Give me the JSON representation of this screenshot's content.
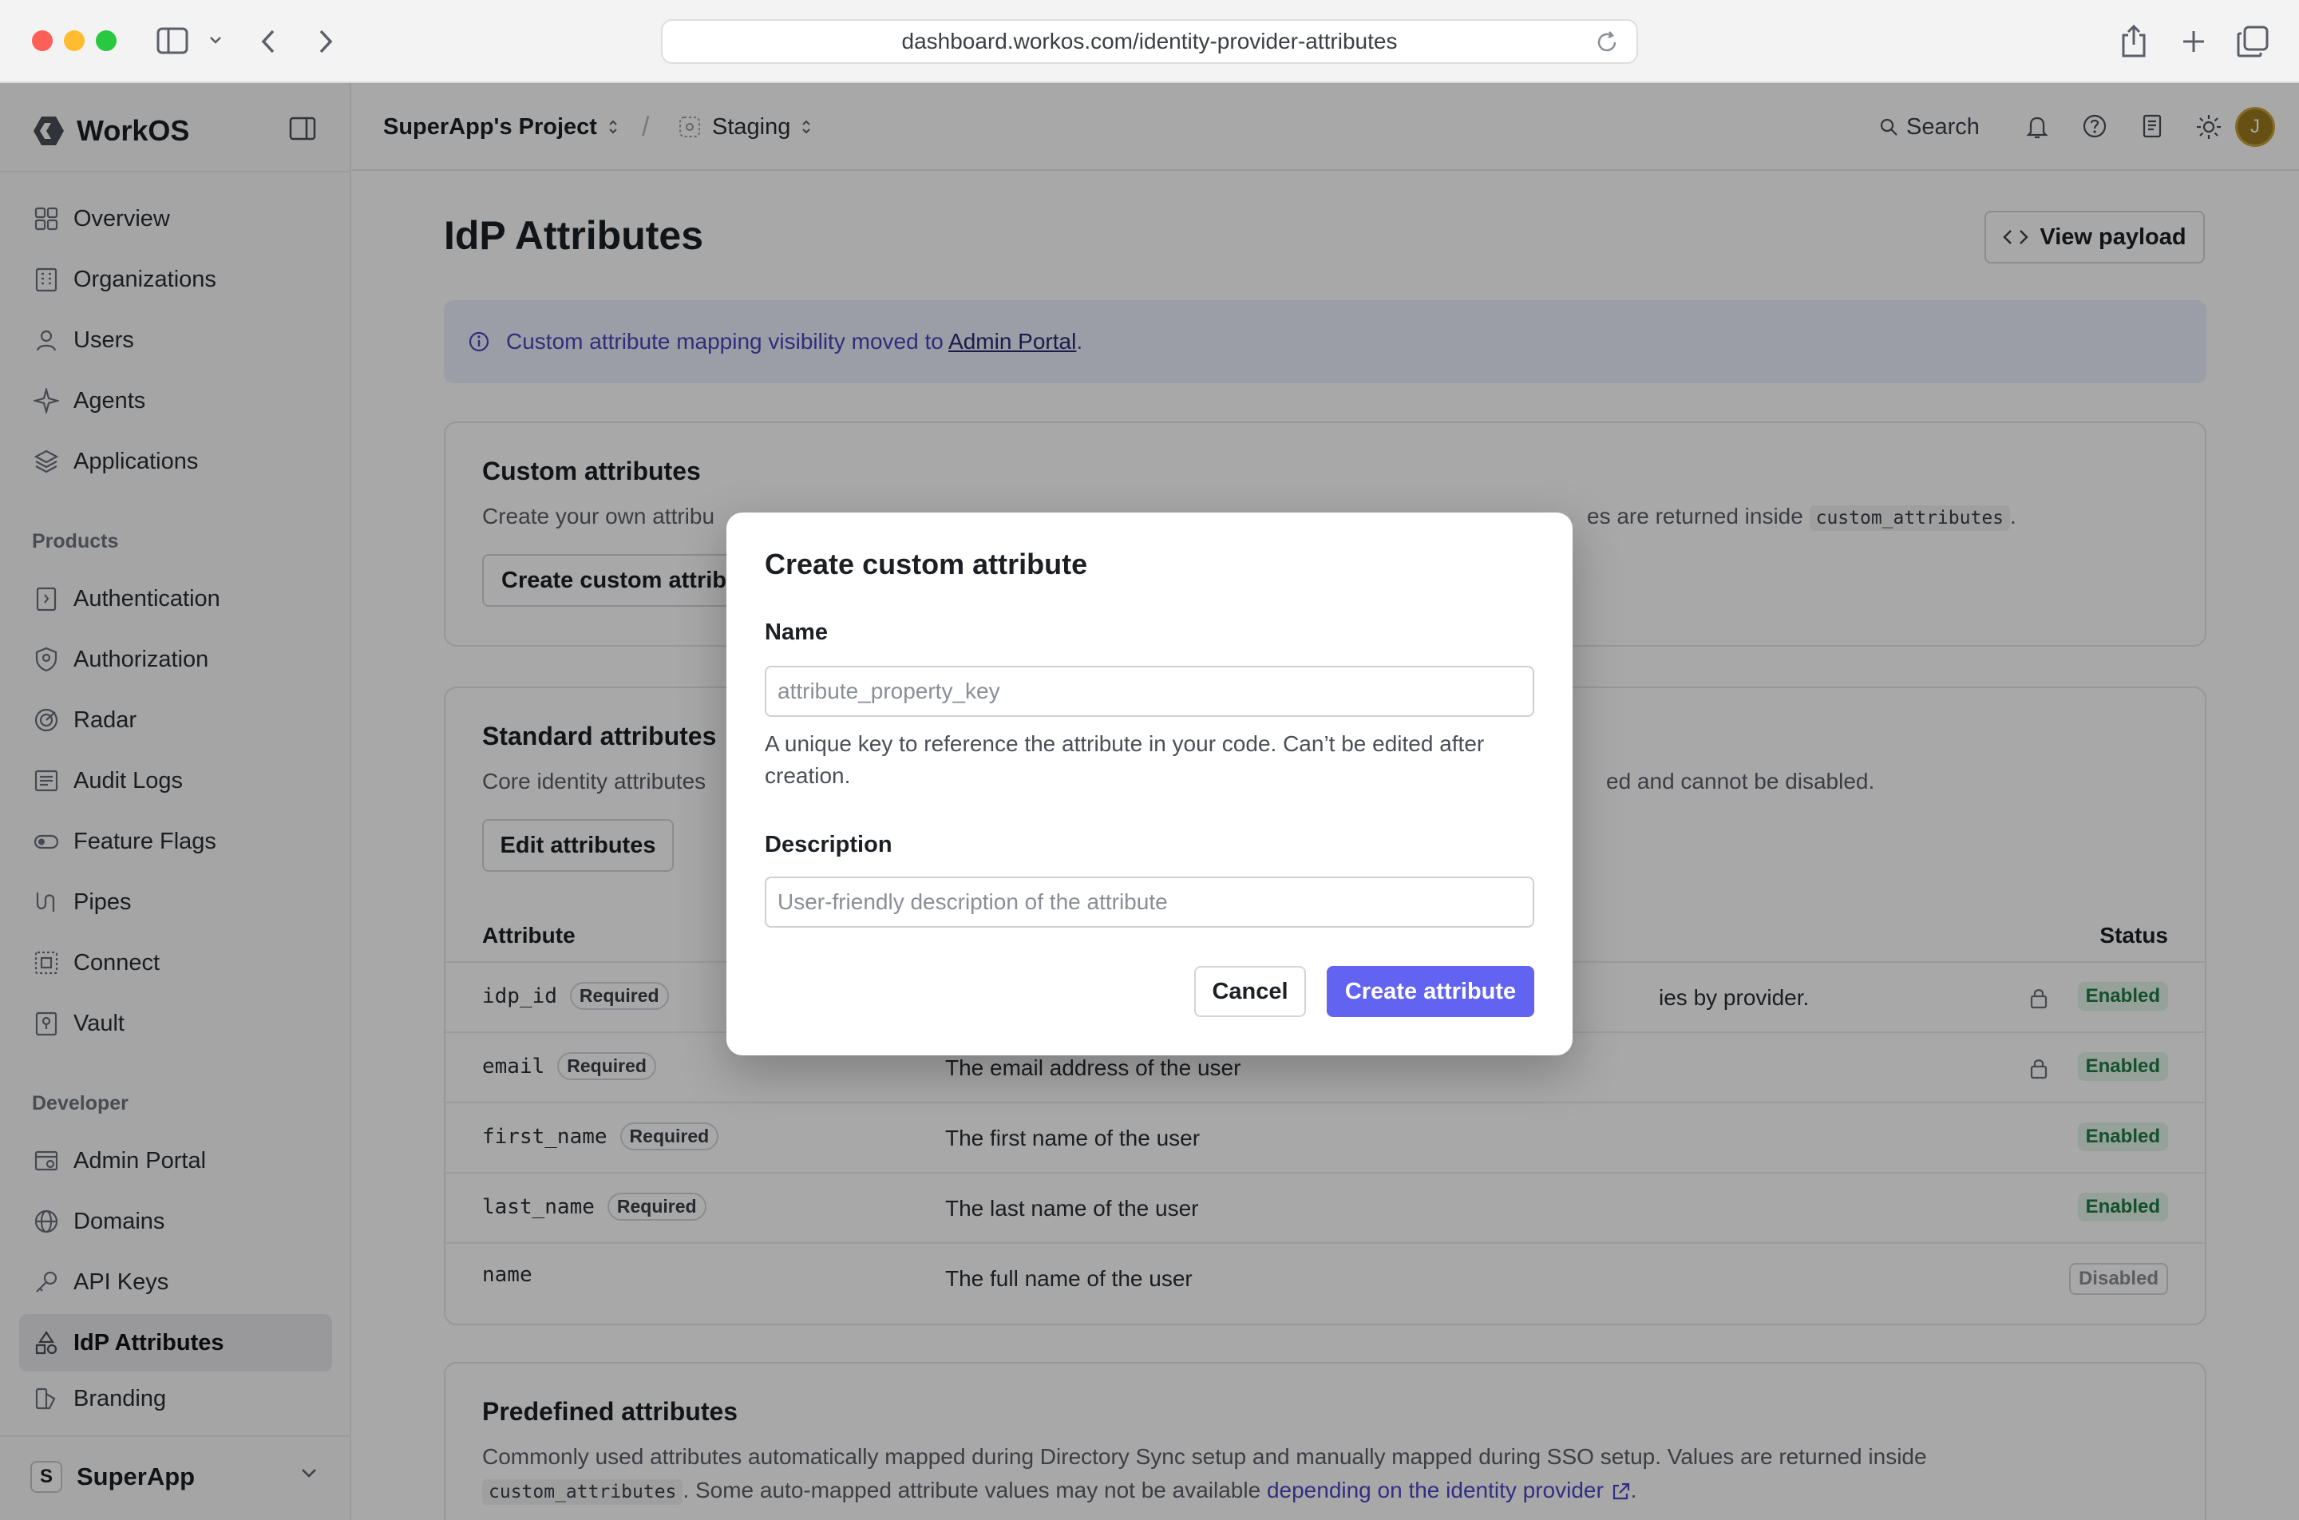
{
  "browser": {
    "url": "dashboard.workos.com/identity-provider-attributes"
  },
  "sidebar": {
    "brand": "WorkOS",
    "nav_top": [
      {
        "label": "Overview",
        "icon": "grid-icon"
      },
      {
        "label": "Organizations",
        "icon": "building-icon"
      },
      {
        "label": "Users",
        "icon": "user-icon"
      },
      {
        "label": "Agents",
        "icon": "sparkle-icon"
      },
      {
        "label": "Applications",
        "icon": "layers-icon"
      }
    ],
    "products_label": "Products",
    "nav_products": [
      {
        "label": "Authentication",
        "icon": "door-icon"
      },
      {
        "label": "Authorization",
        "icon": "shield-icon"
      },
      {
        "label": "Radar",
        "icon": "radar-icon"
      },
      {
        "label": "Audit Logs",
        "icon": "log-icon"
      },
      {
        "label": "Feature Flags",
        "icon": "toggle-icon"
      },
      {
        "label": "Pipes",
        "icon": "pipes-icon"
      },
      {
        "label": "Connect",
        "icon": "connect-icon"
      },
      {
        "label": "Vault",
        "icon": "vault-icon"
      }
    ],
    "developer_label": "Developer",
    "nav_developer": [
      {
        "label": "Admin Portal",
        "icon": "portal-icon"
      },
      {
        "label": "Domains",
        "icon": "globe-icon"
      },
      {
        "label": "API Keys",
        "icon": "key-icon"
      },
      {
        "label": "IdP Attributes",
        "icon": "attributes-icon",
        "active": true
      },
      {
        "label": "Branding",
        "icon": "brush-icon"
      }
    ],
    "workspace": {
      "badge": "S",
      "name": "SuperApp"
    }
  },
  "header": {
    "project": "SuperApp's Project",
    "separator": "/",
    "environment": "Staging",
    "search": "Search",
    "avatar": "J"
  },
  "page": {
    "title": "IdP Attributes",
    "view_payload": "View payload",
    "callout_text": "Custom attribute mapping visibility moved to",
    "callout_link": "Admin Portal",
    "callout_period": "."
  },
  "custom": {
    "title": "Custom attributes",
    "desc_start": "Create your own attribu",
    "desc_end": "es are returned inside",
    "code": "custom_attributes",
    "desc_tail": ".",
    "button": "Create custom attribu"
  },
  "standard": {
    "title": "Standard attributes",
    "desc_start": "Core identity attributes",
    "desc_end": "ed and cannot be disabled.",
    "button": "Edit attributes",
    "col_attribute": "Attribute",
    "col_status": "Status",
    "rows": [
      {
        "key": "idp_id",
        "required": "Required",
        "description": "ies by provider.",
        "status": "Enabled",
        "locked": true
      },
      {
        "key": "email",
        "required": "Required",
        "description": "The email address of the user",
        "status": "Enabled",
        "locked": true
      },
      {
        "key": "first_name",
        "required": "Required",
        "description": "The first name of the user",
        "status": "Enabled",
        "locked": false
      },
      {
        "key": "last_name",
        "required": "Required",
        "description": "The last name of the user",
        "status": "Enabled",
        "locked": false
      },
      {
        "key": "name",
        "required": "",
        "description": "The full name of the user",
        "status": "Disabled",
        "locked": false
      }
    ]
  },
  "predefined": {
    "title": "Predefined attributes",
    "desc_line1": "Commonly used attributes automatically mapped during Directory Sync setup and manually mapped during SSO setup. Values are returned inside",
    "code": "custom_attributes",
    "desc_line2": ". Some auto-mapped attribute values may not be available",
    "link": "depending on the identity provider",
    "desc_tail": "."
  },
  "modal": {
    "title": "Create custom attribute",
    "name_label": "Name",
    "name_placeholder": "attribute_property_key",
    "name_value": "",
    "help": "A unique key to reference the attribute in your code. Can’t be edited after creation.",
    "description_label": "Description",
    "description_placeholder": "User-friendly description of the attribute",
    "description_value": "",
    "cancel": "Cancel",
    "submit": "Create attribute"
  },
  "colors": {
    "accent": "#6363f1",
    "enabled_bg": "#e4f5ea",
    "enabled_text": "#1f7a47",
    "callout_bg": "#eceefd"
  }
}
